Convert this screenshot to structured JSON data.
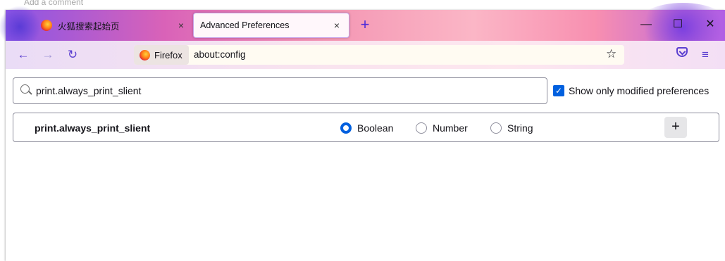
{
  "background": {
    "comment_text": "Add a comment"
  },
  "tabs": [
    {
      "title": "火狐搜索起始页",
      "close": "×",
      "active": false
    },
    {
      "title": "Advanced Preferences",
      "close": "×",
      "active": true
    }
  ],
  "new_tab_label": "+",
  "window_controls": {
    "minimize": "—",
    "maximize": "☐",
    "close": "✕"
  },
  "nav": {
    "back": "←",
    "forward": "→",
    "reload": "↻",
    "identity_label": "Firefox",
    "url": "about:config",
    "bookmark_star": "☆",
    "menu": "≡"
  },
  "config": {
    "search_value": "print.always_print_slient",
    "show_modified_label": "Show only modified preferences",
    "show_modified_checked": true,
    "check_glyph": "✓",
    "pref_name": "print.always_print_slient",
    "types": [
      {
        "label": "Boolean",
        "selected": true
      },
      {
        "label": "Number",
        "selected": false
      },
      {
        "label": "String",
        "selected": false
      }
    ],
    "add_button": "+"
  },
  "colors": {
    "accent": "#0060df",
    "toolbar_icons": "#5b3fd0"
  }
}
